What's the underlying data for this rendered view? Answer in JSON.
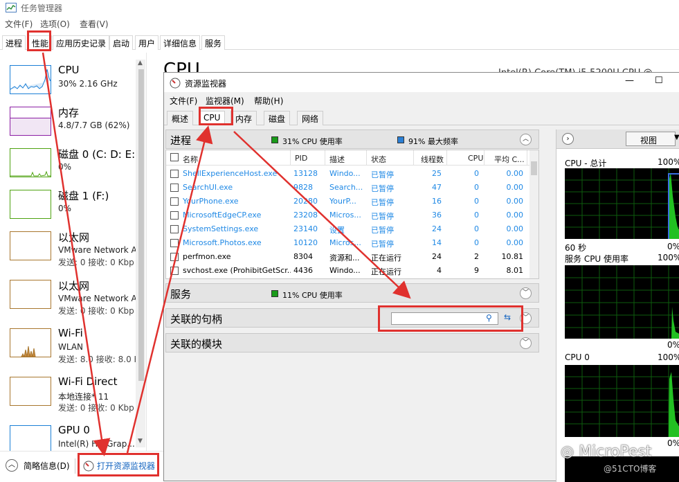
{
  "task_manager": {
    "title": "任务管理器",
    "menu": [
      "文件(F)",
      "选项(O)",
      "查看(V)"
    ],
    "tabs": [
      "进程",
      "性能",
      "应用历史记录",
      "启动",
      "用户",
      "详细信息",
      "服务"
    ],
    "active_tab": "性能",
    "sidebar": [
      {
        "name": "CPU",
        "line1": "30% 2.16 GHz",
        "line2": "",
        "color": "#1b7fd6"
      },
      {
        "name": "内存",
        "line1": "4.8/7.7 GB (62%)",
        "line2": "",
        "color": "#8b1ea3"
      },
      {
        "name": "磁盘 0 (C: D: E:",
        "line1": "0%",
        "line2": "",
        "color": "#4da20f"
      },
      {
        "name": "磁盘 1 (F:)",
        "line1": "0%",
        "line2": "",
        "color": "#4da20f"
      },
      {
        "name": "以太网",
        "line1": "VMware Network A",
        "line2": "发送: 0 接收: 0 Kbp",
        "color": "#a8762d"
      },
      {
        "name": "以太网",
        "line1": "VMware Network A",
        "line2": "发送: 0 接收: 0 Kbp",
        "color": "#a8762d"
      },
      {
        "name": "Wi-Fi",
        "line1": "WLAN",
        "line2": "发送: 8.0 接收: 8.0 K",
        "color": "#a8762d"
      },
      {
        "name": "Wi-Fi Direct",
        "line1": "本地连接* 11",
        "line2": "发送: 0 接收: 0 Kbp",
        "color": "#a8762d"
      },
      {
        "name": "GPU 0",
        "line1": "Intel(R) HD Grap...",
        "line2": "",
        "color": "#1b7fd6"
      }
    ],
    "main_heading": "CPU",
    "main_heading_right": "Intel(R) Core(TM) i5-5200U CPU @",
    "footer": {
      "summary_label": "简略信息(D)",
      "open_monitor_label": "打开资源监视器"
    }
  },
  "resource_monitor": {
    "title": "资源监视器",
    "window_controls": [
      "—",
      "☐"
    ],
    "menu": [
      "文件(F)",
      "监视器(M)",
      "帮助(H)"
    ],
    "tabs": [
      "概述",
      "CPU",
      "内存",
      "磁盘",
      "网络"
    ],
    "active_tab": "CPU",
    "processes": {
      "title": "进程",
      "cpu_usage": "31% CPU 使用率",
      "max_freq": "91% 最大频率",
      "columns": [
        "名称",
        "PID",
        "描述",
        "状态",
        "线程数",
        "CPU",
        "平均 C..."
      ],
      "rows": [
        {
          "name": "ShellExperienceHost.exe",
          "pid": "13128",
          "desc": "Windo...",
          "status": "已暂停",
          "threads": "25",
          "cpu": "0",
          "avg": "0.00",
          "suspended": true
        },
        {
          "name": "SearchUI.exe",
          "pid": "9828",
          "desc": "Search...",
          "status": "已暂停",
          "threads": "47",
          "cpu": "0",
          "avg": "0.00",
          "suspended": true
        },
        {
          "name": "YourPhone.exe",
          "pid": "20280",
          "desc": "YourP...",
          "status": "已暂停",
          "threads": "16",
          "cpu": "0",
          "avg": "0.00",
          "suspended": true
        },
        {
          "name": "MicrosoftEdgeCP.exe",
          "pid": "23208",
          "desc": "Micros...",
          "status": "已暂停",
          "threads": "36",
          "cpu": "0",
          "avg": "0.00",
          "suspended": true
        },
        {
          "name": "SystemSettings.exe",
          "pid": "23140",
          "desc": "设置",
          "status": "已暂停",
          "threads": "24",
          "cpu": "0",
          "avg": "0.00",
          "suspended": true
        },
        {
          "name": "Microsoft.Photos.exe",
          "pid": "10120",
          "desc": "Micros...",
          "status": "已暂停",
          "threads": "14",
          "cpu": "0",
          "avg": "0.00",
          "suspended": true
        },
        {
          "name": "perfmon.exe",
          "pid": "8304",
          "desc": "资源和...",
          "status": "正在运行",
          "threads": "24",
          "cpu": "2",
          "avg": "10.81",
          "suspended": false
        },
        {
          "name": "svchost.exe (ProhibitGetScr...",
          "pid": "4436",
          "desc": "Windo...",
          "status": "正在运行",
          "threads": "4",
          "cpu": "9",
          "avg": "8.01",
          "suspended": false
        }
      ]
    },
    "services": {
      "title": "服务",
      "cpu_usage": "11% CPU 使用率"
    },
    "handles": {
      "title": "关联的句柄",
      "search_value": ""
    },
    "modules": {
      "title": "关联的模块"
    },
    "right_pane": {
      "view_label": "视图",
      "graphs": [
        {
          "label": "CPU - 总计",
          "top_pct": "100%",
          "time": "60 秒",
          "bottom_pct": "0%"
        },
        {
          "label": "服务 CPU 使用率",
          "top_pct": "100%",
          "time": "",
          "bottom_pct": "0%"
        },
        {
          "label": "CPU 0",
          "top_pct": "100%",
          "time": "",
          "bottom_pct": "0%"
        }
      ]
    }
  },
  "watermark": {
    "brand": "MicroPest",
    "site": "@51CTO博客"
  },
  "colors": {
    "highlight": "#e0312e",
    "suspended_text": "#1e88e5",
    "cpu_legend": "#1a9b1a",
    "freq_legend": "#2a7fd4"
  }
}
